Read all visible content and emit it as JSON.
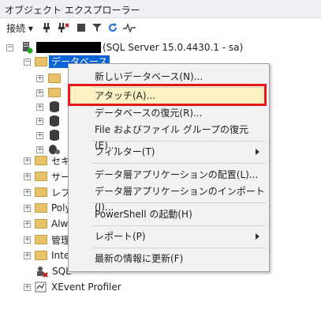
{
  "window": {
    "title": "オブジェクト エクスプローラー"
  },
  "toolbar": {
    "connect_label": "接続 ▾",
    "icons": [
      "connect-icon",
      "disconnect-icon",
      "stop-icon",
      "filter-icon",
      "refresh-icon",
      "activity-monitor-icon"
    ]
  },
  "tree": {
    "server_label": "(SQL Server 15.0.4430.1 - sa)",
    "databases_label": "データベース",
    "items": [
      {
        "label": "セキ"
      },
      {
        "label": "サー"
      },
      {
        "label": "レプ"
      },
      {
        "label": "Poly"
      },
      {
        "label": "Alw"
      },
      {
        "label": "管理"
      },
      {
        "label": "Inte"
      },
      {
        "label": "SQL"
      },
      {
        "label": "XEvent Profiler"
      }
    ]
  },
  "context_menu": {
    "new_database": "新しいデータベース(N)...",
    "attach": "アタッチ(A)...",
    "restore_database": "データベースの復元(R)...",
    "restore_files": "File およびファイル グループの復元(E)...",
    "filter": "フィルター(T)",
    "deploy_dac": "データ層アプリケーションの配置(L)...",
    "import_dac": "データ層アプリケーションのインポート(I)...",
    "powershell": "PowerShell の起動(H)",
    "reports": "レポート(P)",
    "refresh": "最新の情報に更新(F)"
  },
  "colors": {
    "selection": "#0a64d6",
    "highlight_box": "#e8171c",
    "menu_hover": "#fcf3c4"
  }
}
